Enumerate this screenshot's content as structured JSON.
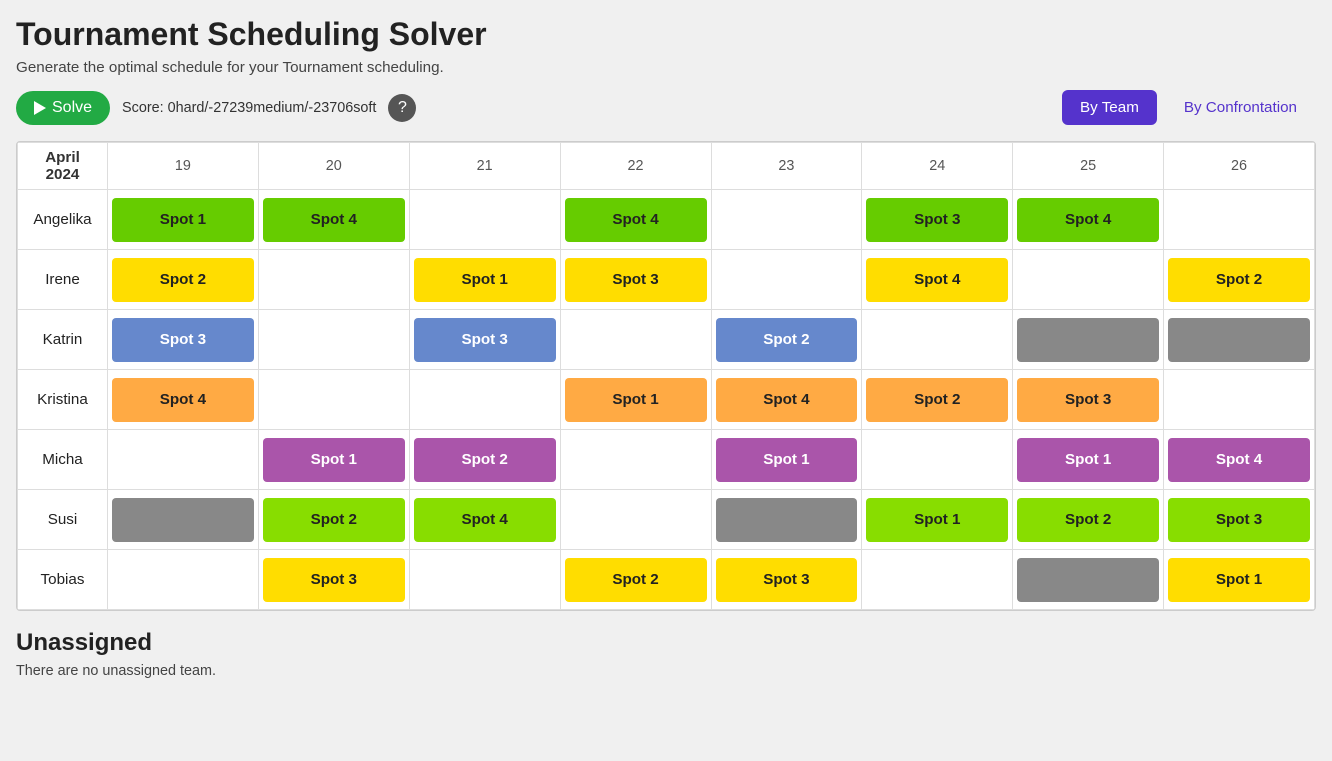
{
  "app": {
    "title": "Tournament Scheduling Solver",
    "subtitle": "Generate the optimal schedule for your Tournament scheduling.",
    "score_label": "Score: 0hard/-27239medium/-23706soft"
  },
  "toolbar": {
    "solve_button": "Solve",
    "help_tooltip": "?",
    "view_by_team": "By Team",
    "view_by_confrontation": "By Confrontation"
  },
  "schedule": {
    "month": "April 2024",
    "dates": [
      "19",
      "20",
      "21",
      "22",
      "23",
      "24",
      "25",
      "26"
    ],
    "rows": [
      {
        "name": "Angelika",
        "cells": [
          {
            "spot": "Spot 1",
            "color": "green"
          },
          {
            "spot": "Spot 4",
            "color": "green"
          },
          {
            "spot": "",
            "color": ""
          },
          {
            "spot": "Spot 4",
            "color": "green"
          },
          {
            "spot": "",
            "color": ""
          },
          {
            "spot": "Spot 3",
            "color": "green"
          },
          {
            "spot": "Spot 4",
            "color": "green"
          },
          {
            "spot": "",
            "color": ""
          }
        ]
      },
      {
        "name": "Irene",
        "cells": [
          {
            "spot": "Spot 2",
            "color": "yellow"
          },
          {
            "spot": "",
            "color": ""
          },
          {
            "spot": "Spot 1",
            "color": "yellow"
          },
          {
            "spot": "Spot 3",
            "color": "yellow"
          },
          {
            "spot": "",
            "color": ""
          },
          {
            "spot": "Spot 4",
            "color": "yellow"
          },
          {
            "spot": "",
            "color": ""
          },
          {
            "spot": "Spot 2",
            "color": "yellow"
          }
        ]
      },
      {
        "name": "Katrin",
        "cells": [
          {
            "spot": "Spot 3",
            "color": "blue"
          },
          {
            "spot": "",
            "color": ""
          },
          {
            "spot": "Spot 3",
            "color": "blue"
          },
          {
            "spot": "",
            "color": ""
          },
          {
            "spot": "Spot 2",
            "color": "blue"
          },
          {
            "spot": "",
            "color": ""
          },
          {
            "spot": "",
            "color": "gray"
          },
          {
            "spot": "",
            "color": "gray"
          }
        ]
      },
      {
        "name": "Kristina",
        "cells": [
          {
            "spot": "Spot 4",
            "color": "orange"
          },
          {
            "spot": "",
            "color": ""
          },
          {
            "spot": "",
            "color": ""
          },
          {
            "spot": "Spot 1",
            "color": "orange"
          },
          {
            "spot": "Spot 4",
            "color": "orange"
          },
          {
            "spot": "Spot 2",
            "color": "orange"
          },
          {
            "spot": "Spot 3",
            "color": "orange"
          },
          {
            "spot": "",
            "color": ""
          }
        ]
      },
      {
        "name": "Micha",
        "cells": [
          {
            "spot": "",
            "color": ""
          },
          {
            "spot": "Spot 1",
            "color": "purple"
          },
          {
            "spot": "Spot 2",
            "color": "purple"
          },
          {
            "spot": "",
            "color": ""
          },
          {
            "spot": "Spot 1",
            "color": "purple"
          },
          {
            "spot": "",
            "color": ""
          },
          {
            "spot": "Spot 1",
            "color": "purple"
          },
          {
            "spot": "Spot 4",
            "color": "purple"
          }
        ]
      },
      {
        "name": "Susi",
        "cells": [
          {
            "spot": "",
            "color": "gray"
          },
          {
            "spot": "Spot 2",
            "color": "lime"
          },
          {
            "spot": "Spot 4",
            "color": "lime"
          },
          {
            "spot": "",
            "color": ""
          },
          {
            "spot": "",
            "color": "gray"
          },
          {
            "spot": "Spot 1",
            "color": "lime"
          },
          {
            "spot": "Spot 2",
            "color": "lime"
          },
          {
            "spot": "Spot 3",
            "color": "lime"
          }
        ]
      },
      {
        "name": "Tobias",
        "cells": [
          {
            "spot": "",
            "color": ""
          },
          {
            "spot": "Spot 3",
            "color": "yellow"
          },
          {
            "spot": "",
            "color": ""
          },
          {
            "spot": "Spot 2",
            "color": "yellow"
          },
          {
            "spot": "Spot 3",
            "color": "yellow"
          },
          {
            "spot": "",
            "color": ""
          },
          {
            "spot": "",
            "color": "gray"
          },
          {
            "spot": "Spot 1",
            "color": "yellow"
          }
        ]
      }
    ]
  },
  "unassigned": {
    "title": "Unassigned",
    "text": "There are no unassigned team."
  }
}
